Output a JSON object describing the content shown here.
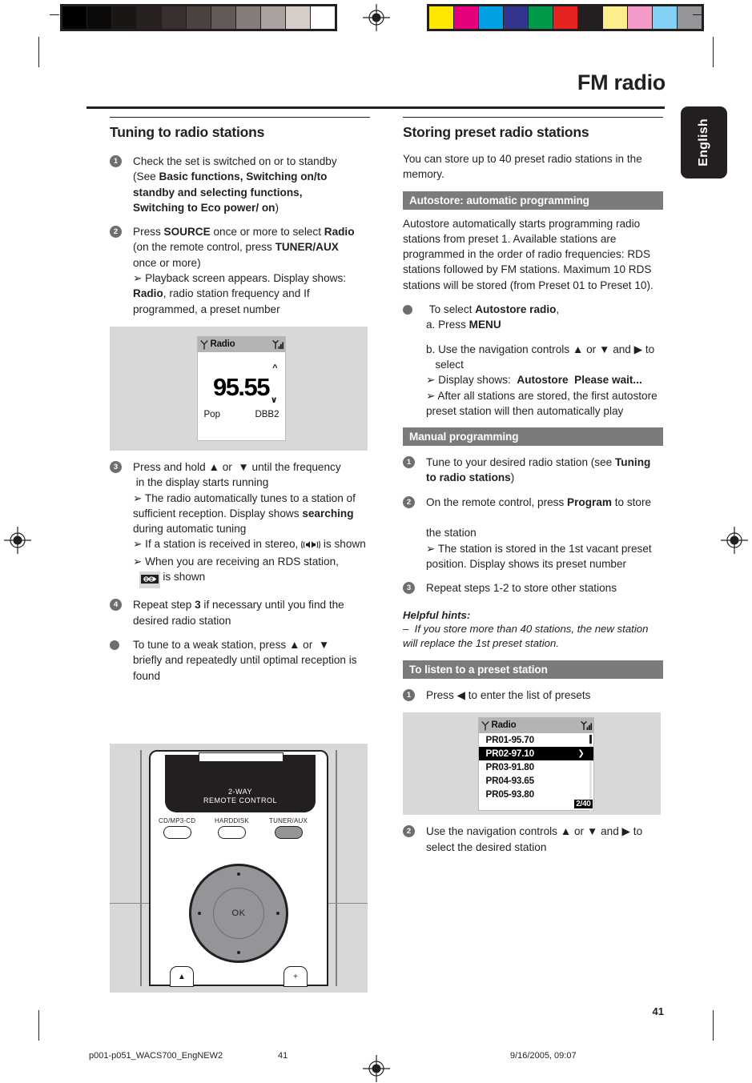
{
  "header": {
    "title": "FM radio",
    "language_tab": "English"
  },
  "left_column": {
    "section_title": "Tuning to radio stations",
    "steps": [
      {
        "num": "1",
        "html": "Check the set is switched on or to standby<br>(See <b>Basic functions, Switching on/to<br>standby and selecting functions,<br>Switching to Eco power/ on</b>)"
      },
      {
        "num": "2",
        "html": "Press <b>SOURCE</b> once or more to select <b>Radio</b><br>(on the remote control, press <b>TUNER/AUX</b><br>once or more)<br><span class=\"arrowglyph\">&#10146;</span> Playback screen appears. Display shows:<br><b>Radio</b>, radio station frequency and If<br>programmed, a preset number"
      },
      {
        "num": "3",
        "html": "Press and hold &#9650; or &nbsp;&#9660; until the frequency<br>&nbsp;in the display starts running<br><span class=\"arrowglyph\">&#10146;</span> The radio automatically tunes to a station of<br>sufficient reception. Display shows <b>searching</b><br>during automatic tuning<br><span class=\"arrowglyph\">&#10146;</span> If a station is received in stereo, STEREO_ICON is shown<br><span class=\"arrowglyph\">&#10146;</span> When you are receiving an RDS station,<br>&nbsp;&nbsp;RDS_ICON is shown"
      },
      {
        "num": "4",
        "html": "Repeat step <b>3</b> if necessary until you find the<br>desired radio station"
      },
      {
        "bullet": true,
        "html": "To tune to a weak station, press &#9650; or &nbsp;&#9660;<br>briefly and repeatedly until optimal reception is<br>found"
      }
    ],
    "lcd_playback": {
      "title": "Radio",
      "frequency": "95.55",
      "preset_label": "Pop",
      "sound_mode": "DBB2",
      "antenna_icon": "antenna-icon",
      "signal_icon": "signal-strength-icon"
    }
  },
  "right_column": {
    "section_title": "Storing preset radio stations",
    "intro": "You can store up to 40 preset radio stations in the memory.",
    "autostore_bar": "Autostore: automatic programming",
    "autostore_body": "Autostore automatically starts programming radio stations from preset 1.  Available stations are programmed in the order of radio frequencies: RDS stations followed by FM stations. Maximum 10 RDS stations will be stored (from Preset 01 to Preset 10).",
    "autostore_steps": [
      {
        "bullet": true,
        "html": "&nbsp;To select <b>Autostore radio</b>,<br>a. Press <b>MENU</b>"
      },
      {
        "plain": true,
        "html": "b. Use the navigation controls &#9650; or &#9660; and <b>&#9654;</b> to<br>&nbsp;&nbsp;&nbsp;select<br><span class=\"arrowglyph\">&#10146;</span> Display shows: &nbsp;<b>Autostore &nbsp;Please wait...</b><br><span class=\"arrowglyph\">&#10146;</span> After all stations are stored, the first autostore<br>preset station will then automatically play"
      }
    ],
    "manual_bar": "Manual programming",
    "manual_steps": [
      {
        "num": "1",
        "html": "Tune to your desired radio station (see <b>Tuning<br>to radio stations</b>)"
      },
      {
        "num": "2",
        "html": "On the remote control, press <b>Program</b> to store<br><br>the station<br><span class=\"arrowglyph\">&#10146;</span> The station is stored in the 1st vacant preset<br>position. Display shows its preset number"
      },
      {
        "num": "3",
        "html": "Repeat steps 1-2 to store other stations"
      }
    ],
    "hint_title": "Helpful hints:",
    "hint_body": "&#8211; &nbsp;If you store more than 40 stations, the new station will replace the 1st preset station.",
    "listen_bar": "To listen to a preset station",
    "listen_steps": [
      {
        "num": "1",
        "html": "Press <b>&#9664;</b> to enter the list of presets"
      },
      {
        "num": "2",
        "html": "Use the navigation controls &#9650; or &#9660; and <b>&#9654;</b> to<br>select the desired station"
      }
    ],
    "lcd_presets": {
      "title": "Radio",
      "rows": [
        {
          "label": "PR01-95.70",
          "selected": false
        },
        {
          "label": "PR02-97.10",
          "selected": true
        },
        {
          "label": "PR03-91.80",
          "selected": false
        },
        {
          "label": "PR04-93.65",
          "selected": false
        },
        {
          "label": "PR05-93.80",
          "selected": false
        }
      ],
      "page_count": "2/40",
      "antenna_icon": "antenna-icon",
      "signal_icon": "signal-strength-icon"
    }
  },
  "remote_figure": {
    "window_line1": "2-WAY",
    "window_line2": "REMOTE CONTROL",
    "buttons": [
      {
        "label": "CD/MP3-CD",
        "active": false
      },
      {
        "label": "HARDDISK",
        "active": false
      },
      {
        "label": "TUNER/AUX",
        "active": true
      }
    ],
    "wheel_label": "OK",
    "low_left_label": "▲",
    "low_right_label": "+"
  },
  "footer": {
    "page_number": "41",
    "file_name": "p001-p051_WACS700_EngNEW2",
    "file_page": "41",
    "timestamp": "9/16/2005, 09:07"
  },
  "calibration": {
    "gray_swatches": [
      "#000000",
      "#0c0a09",
      "#1a1614",
      "#272120",
      "#38302e",
      "#4b4240",
      "#635a57",
      "#867d7a",
      "#aaa09d",
      "#d6cdc9",
      "#ffffff"
    ],
    "color_swatches": [
      "#ffe800",
      "#e6007e",
      "#00a0e3",
      "#33348e",
      "#009b4a",
      "#e52421",
      "#231f20",
      "#fdee8c",
      "#f39ac8",
      "#83d2f5",
      "#939598"
    ]
  }
}
